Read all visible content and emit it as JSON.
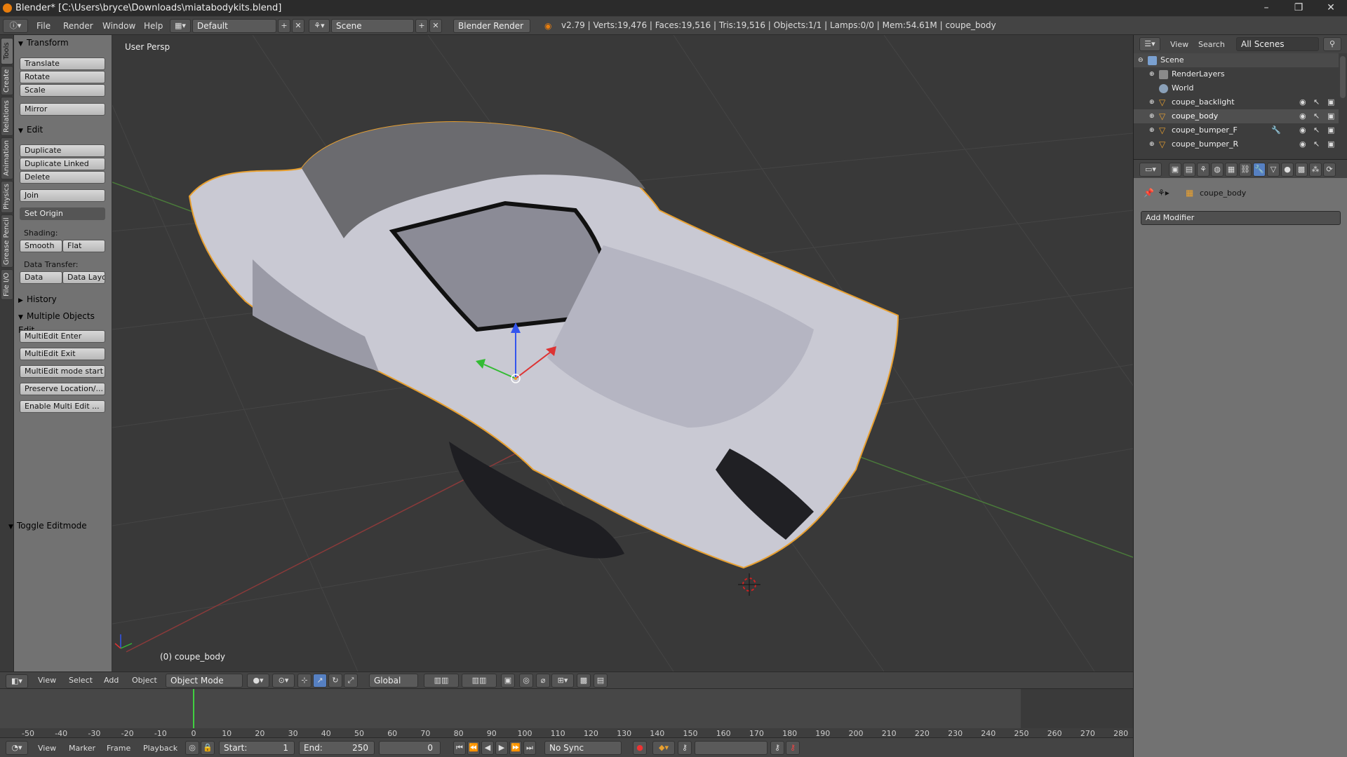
{
  "window": {
    "title": "Blender* [C:\\Users\\bryce\\Downloads\\miatabodykits.blend]",
    "controls": [
      "–",
      "❐",
      "✕"
    ]
  },
  "topbar": {
    "menus": [
      "File",
      "Render",
      "Window",
      "Help"
    ],
    "layout": "Default",
    "scene": "Scene",
    "engine": "Blender Render",
    "stats": "v2.79 | Verts:19,476 | Faces:19,516 | Tris:19,516 | Objects:1/1 | Lamps:0/0 | Mem:54.61M | coupe_body"
  },
  "vtabs": [
    "Tools",
    "Create",
    "Relations",
    "Animation",
    "Physics",
    "Grease Pencil",
    "File I/O"
  ],
  "toolshelf": {
    "transform": {
      "title": "Transform",
      "buttons": [
        "Translate",
        "Rotate",
        "Scale",
        "Mirror"
      ]
    },
    "edit": {
      "title": "Edit",
      "buttons": [
        "Duplicate",
        "Duplicate Linked",
        "Delete",
        "Join"
      ],
      "set_origin": "Set Origin",
      "shading_label": "Shading:",
      "smooth": "Smooth",
      "flat": "Flat",
      "data_transfer_label": "Data Transfer:",
      "data": "Data",
      "data_layo": "Data Layo"
    },
    "history": "History",
    "multi": {
      "title": "Multiple Objects Edit",
      "buttons": [
        "MultiEdit Enter",
        "MultiEdit Exit",
        "MultiEdit mode start",
        "Preserve Location/...",
        "Enable Multi Edit ..."
      ]
    },
    "toggle_editmode": "Toggle Editmode"
  },
  "viewport": {
    "label": "User Persp",
    "object": "(0) coupe_body"
  },
  "view3d_header": {
    "menus": [
      "View",
      "Select",
      "Add",
      "Object"
    ],
    "mode": "Object Mode",
    "orientation": "Global"
  },
  "timeline": {
    "ticks": [
      "-50",
      "-40",
      "-30",
      "-20",
      "-10",
      "0",
      "10",
      "20",
      "30",
      "40",
      "50",
      "60",
      "70",
      "80",
      "90",
      "100",
      "110",
      "120",
      "130",
      "140",
      "150",
      "160",
      "170",
      "180",
      "190",
      "200",
      "210",
      "220",
      "230",
      "240",
      "250",
      "260",
      "270",
      "280"
    ],
    "current_frame_value": 0
  },
  "bottombar": {
    "menus": [
      "View",
      "Marker",
      "Frame",
      "Playback"
    ],
    "start_label": "Start:",
    "start": "1",
    "end_label": "End:",
    "end": "250",
    "current": "0",
    "sync": "No Sync"
  },
  "outliner": {
    "view": "View",
    "search": "Search",
    "filter": "All Scenes",
    "items": [
      "Scene",
      "RenderLayers",
      "World",
      "coupe_backlight",
      "coupe_body",
      "coupe_bumper_F",
      "coupe_bumper_R"
    ]
  },
  "properties": {
    "object": "coupe_body",
    "add_modifier": "Add Modifier"
  },
  "colors": {
    "selection_outline": "#e8a030",
    "accent_blue": "#5680c2",
    "grid_x": "#8a3a3a",
    "grid_y": "#4a7a3a"
  }
}
